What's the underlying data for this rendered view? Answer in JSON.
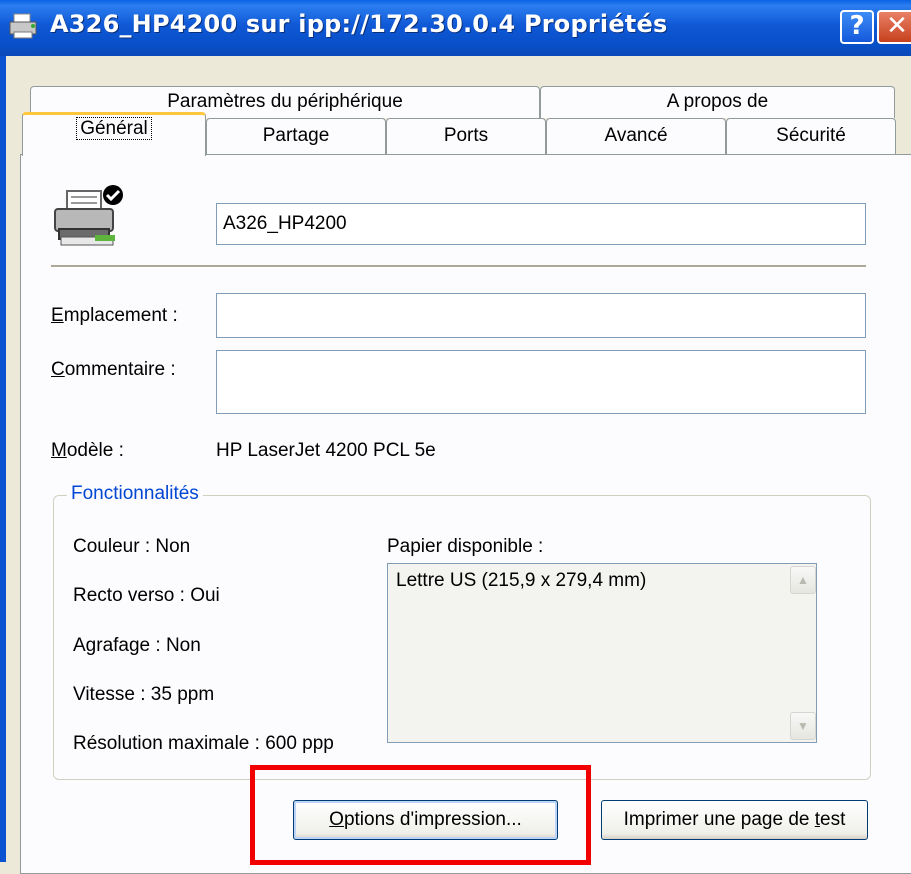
{
  "window": {
    "title": "A326_HP4200 sur ipp://172.30.0.4 Propriétés",
    "help_button": "?",
    "close_button": "✕"
  },
  "tabs_row1": [
    "Paramètres du périphérique",
    "A propos de"
  ],
  "tabs_row2": [
    "Général",
    "Partage",
    "Ports",
    "Avancé",
    "Sécurité"
  ],
  "active_tab": "Général",
  "general": {
    "printer_name": "A326_HP4200",
    "location_label_u": "E",
    "location_label_rest": "mplacement :",
    "location_value": "",
    "comment_label_u": "C",
    "comment_label_rest": "ommentaire :",
    "comment_value": "",
    "model_label_u": "M",
    "model_label_rest": "odèle :",
    "model_value": "HP LaserJet 4200 PCL 5e"
  },
  "features": {
    "title": "Fonctionnalités",
    "color": "Couleur : Non",
    "duplex": "Recto verso : Oui",
    "staple": "Agrafage : Non",
    "speed": "Vitesse : 35 ppm",
    "resolution": "Résolution maximale : 600 ppp",
    "paper_label": "Papier disponible :",
    "paper_items": [
      "Lettre US (215,9 x 279,4 mm)"
    ]
  },
  "buttons": {
    "options_u": "O",
    "options_rest": "ptions d'impression...",
    "test_pre": "Imprimer une page de ",
    "test_u": "t",
    "test_post": "est"
  },
  "colors": {
    "titlebar": "#0A58D8",
    "highlight": "#F20000",
    "group_title": "#0046D5"
  }
}
